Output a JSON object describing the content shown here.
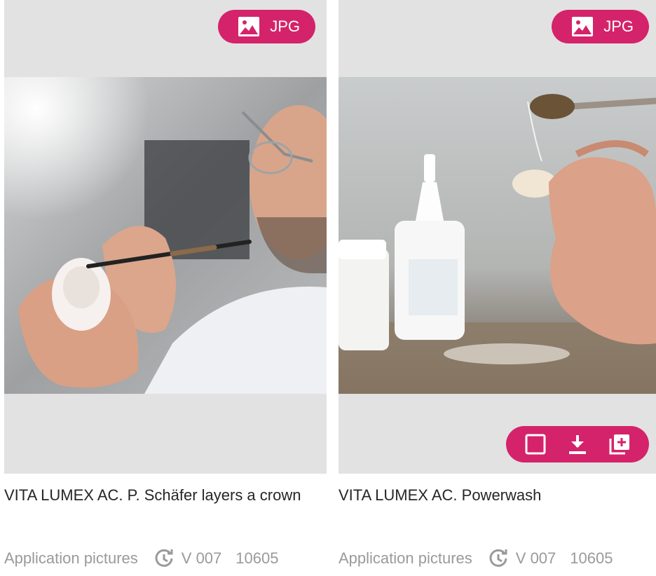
{
  "colors": {
    "accent": "#d4236a",
    "panel": "#e2e2e2",
    "title_text": "#262626",
    "meta_text": "#9a9a9a"
  },
  "cards": [
    {
      "badge_label": "JPG",
      "badge_icon": "image-icon",
      "photo_subject": "dental technician layering a crown",
      "title": "VITA LUMEX AC. P. Schäfer layers a crown",
      "category": "Application pictures",
      "version_icon": "history-icon",
      "version": "V 007",
      "code": "10605"
    },
    {
      "badge_label": "JPG",
      "badge_icon": "image-icon",
      "photo_subject": "powder brushed onto a tooth with bottles",
      "title": "VITA LUMEX AC. Powerwash",
      "category": "Application pictures",
      "version_icon": "history-icon",
      "version": "V 007",
      "code": "10605",
      "actions": [
        {
          "icon": "checkbox-icon",
          "label": "select"
        },
        {
          "icon": "download-icon",
          "label": "download"
        },
        {
          "icon": "add-to-collection-icon",
          "label": "add"
        }
      ]
    }
  ]
}
